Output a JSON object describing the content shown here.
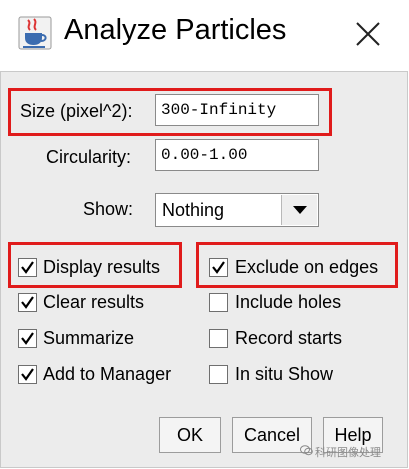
{
  "window": {
    "title": "Analyze Particles",
    "app_icon": "java-cup-icon",
    "close_icon": "close-x-icon"
  },
  "size": {
    "label": "Size (pixel^2):",
    "value": "300-Infinity"
  },
  "circularity": {
    "label": "Circularity:",
    "value": "0.00-1.00"
  },
  "show": {
    "label": "Show:",
    "value": "Nothing"
  },
  "checkboxes": {
    "display_results": {
      "label": "Display results",
      "checked": true
    },
    "clear_results": {
      "label": "Clear results",
      "checked": true
    },
    "summarize": {
      "label": "Summarize",
      "checked": true
    },
    "add_to_manager": {
      "label": "Add to Manager",
      "checked": true
    },
    "exclude_on_edges": {
      "label": "Exclude on edges",
      "checked": true
    },
    "include_holes": {
      "label": "Include holes",
      "checked": false
    },
    "record_starts": {
      "label": "Record starts",
      "checked": false
    },
    "in_situ_show": {
      "label": "In situ Show",
      "checked": false
    }
  },
  "buttons": {
    "ok": "OK",
    "cancel": "Cancel",
    "help": "Help"
  },
  "watermark": {
    "text": "科研图像处理",
    "icon": "wechat-icon"
  },
  "colors": {
    "highlight_box": "#e01b1b",
    "dialog_bg": "#ececec"
  }
}
